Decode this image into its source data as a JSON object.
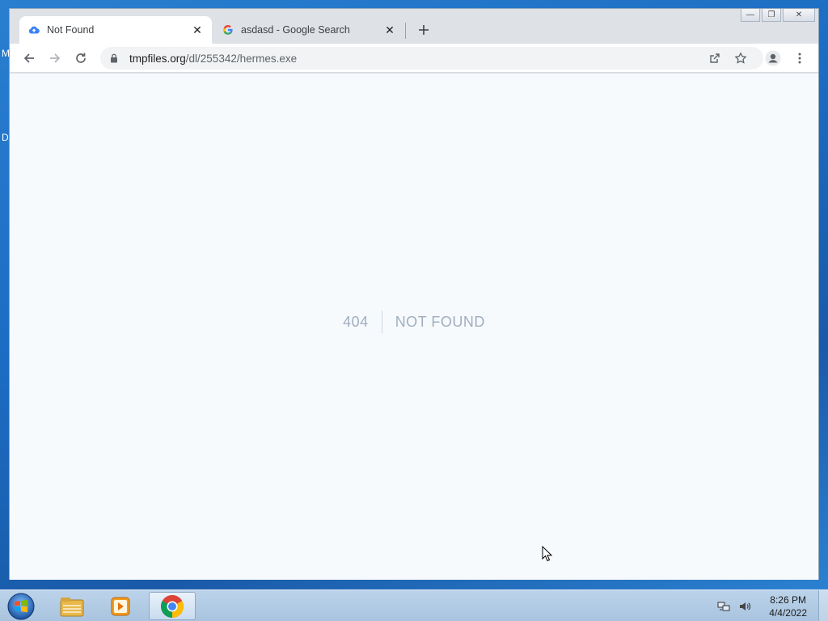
{
  "desktop": {
    "fragments": [
      "M",
      "D"
    ]
  },
  "window": {
    "tabs": [
      {
        "title": "Not Found",
        "icon": "cloud-upload-icon",
        "active": true
      },
      {
        "title": "asdasd - Google Search",
        "icon": "google-g-icon",
        "active": false
      }
    ],
    "controls": {
      "minimize": "—",
      "restore": "❐",
      "close": "✕"
    }
  },
  "toolbar": {
    "url_host": "tmpfiles.org",
    "url_path": "/dl/255342/hermes.exe"
  },
  "page": {
    "code": "404",
    "message": "NOT FOUND"
  },
  "taskbar": {
    "apps": [
      "windows-explorer-icon",
      "media-player-icon",
      "chrome-icon"
    ],
    "time": "8:26 PM",
    "date": "4/4/2022"
  },
  "colors": {
    "desktop_bg": "#1b6cc2",
    "tabstrip_bg": "#dee1e6",
    "page_bg": "#f7fafc",
    "notfound_text": "#a0aec0"
  }
}
